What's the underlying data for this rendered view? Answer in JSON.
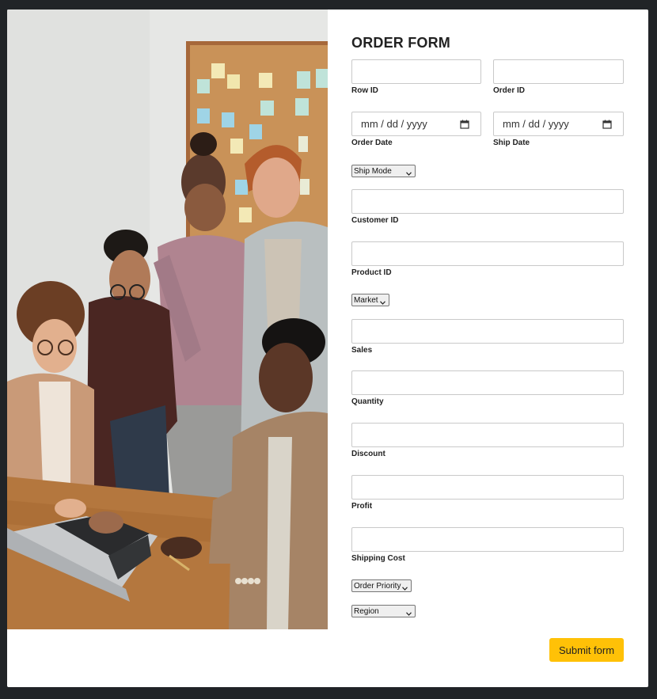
{
  "form": {
    "title": "ORDER FORM",
    "fields": {
      "row_id": {
        "label": "Row ID",
        "value": ""
      },
      "order_id": {
        "label": "Order ID",
        "value": ""
      },
      "order_date": {
        "label": "Order Date",
        "placeholder": "mm / dd / yyyy"
      },
      "ship_date": {
        "label": "Ship Date",
        "placeholder": "mm / dd / yyyy"
      },
      "customer_id": {
        "label": "Customer ID",
        "value": ""
      },
      "product_id": {
        "label": "Product ID",
        "value": ""
      },
      "sales": {
        "label": "Sales",
        "value": ""
      },
      "quantity": {
        "label": "Quantity",
        "value": ""
      },
      "discount": {
        "label": "Discount",
        "value": ""
      },
      "profit": {
        "label": "Profit",
        "value": ""
      },
      "shipping_cost": {
        "label": "Shipping Cost",
        "value": ""
      }
    },
    "selects": {
      "ship_mode": {
        "selected": "Ship Mode"
      },
      "market": {
        "selected": "Market"
      },
      "order_priority": {
        "selected": "Order Priority"
      },
      "region": {
        "selected": "Region"
      }
    },
    "submit_label": "Submit form"
  },
  "photo": {
    "icon": "team-photo",
    "colors": {
      "wall": "#e8e9e7",
      "corkboard": "#c9925a",
      "table": "#b4773e",
      "sticky_notes": [
        "#f3e9b6",
        "#bfe3d9",
        "#9fd4e6",
        "#e9ebd6"
      ]
    }
  },
  "colors": {
    "page_bg": "#212427",
    "card_bg": "#ffffff",
    "submit_bg": "#ffc107",
    "input_border": "#c9c9c9"
  }
}
